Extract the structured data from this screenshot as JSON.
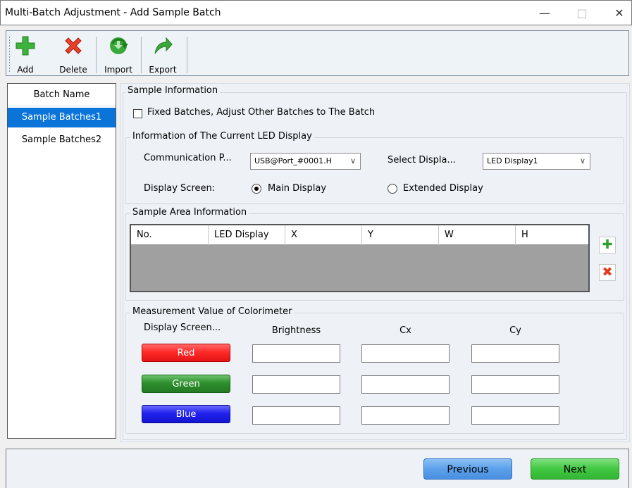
{
  "window": {
    "title": "Multi-Batch Adjustment - Add Sample Batch",
    "minimize": "—",
    "maximize": "□",
    "close": "✕"
  },
  "toolbar": {
    "add": "Add",
    "delete": "Delete",
    "import": "Import",
    "export": "Export"
  },
  "batches": {
    "header": "Batch Name",
    "items": [
      "Sample Batches1",
      "Sample Batches2"
    ],
    "selected": 0
  },
  "sample_info": {
    "title": "Sample Information",
    "fixed_checkbox_label": "Fixed Batches, Adjust Other Batches to The Batch",
    "fixed_checked": false
  },
  "current_display": {
    "title": "Information of The Current LED Display",
    "comm_port_label": "Communication P...",
    "comm_port_value": "USB@Port_#0001.H",
    "select_display_label": "Select Displa...",
    "select_display_value": "LED Display1",
    "display_screen_label": "Display Screen:",
    "main_display": "Main Display",
    "extended_display": "Extended Display",
    "selected_screen": "main"
  },
  "sample_area": {
    "title": "Sample Area Information",
    "columns": [
      "No.",
      "LED Display",
      "X",
      "Y",
      "W",
      "H"
    ],
    "rows": []
  },
  "measurement": {
    "title": "Measurement Value of Colorimeter",
    "display_screen_header": "Display Screen...",
    "brightness_header": "Brightness",
    "cx_header": "Cx",
    "cy_header": "Cy",
    "colors": [
      {
        "label": "Red",
        "hex": "#ff2a2a"
      },
      {
        "label": "Green",
        "hex": "#2e8f2e"
      },
      {
        "label": "Blue",
        "hex": "#2222ee"
      }
    ]
  },
  "footer": {
    "previous": "Previous",
    "next": "Next"
  },
  "accents": {
    "selection": "#0a74d9",
    "previous_button": "#5aa0ea",
    "next_button": "#42c842"
  }
}
